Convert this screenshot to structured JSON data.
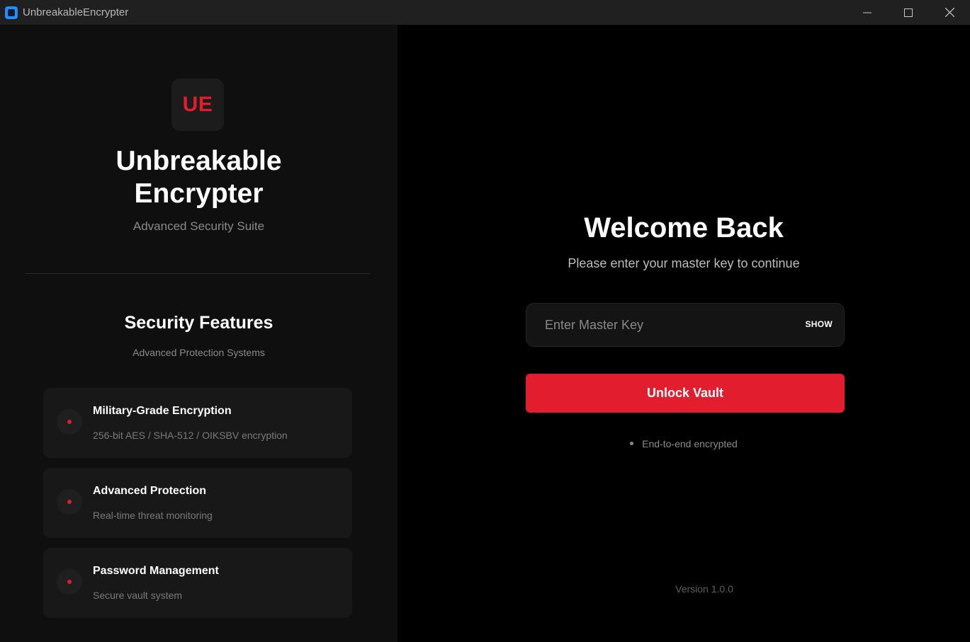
{
  "window": {
    "title": "UnbreakableEncrypter"
  },
  "sidebar": {
    "logo_text": "UE",
    "app_name_line1": "Unbreakable",
    "app_name_line2": "Encrypter",
    "tagline": "Advanced Security Suite",
    "features_title": "Security Features",
    "features_subtitle": "Advanced Protection Systems",
    "features": [
      {
        "title": "Military-Grade Encryption",
        "description": "256-bit AES / SHA-512 / OIKSBV encryption"
      },
      {
        "title": "Advanced Protection",
        "description": "Real-time threat monitoring"
      },
      {
        "title": "Password Management",
        "description": "Secure vault system"
      }
    ]
  },
  "login": {
    "heading": "Welcome Back",
    "subheading": "Please enter your master key to continue",
    "key_placeholder": "Enter Master Key",
    "key_value": "",
    "show_label": "SHOW",
    "unlock_label": "Unlock Vault",
    "e2e_label": "End-to-end encrypted",
    "version": "Version 1.0.0"
  },
  "colors": {
    "accent": "#e11d2e",
    "sidebar_bg": "#0f0f0f",
    "main_bg": "#000000",
    "card_bg": "#181818"
  },
  "icons": {
    "app": "app-icon",
    "minimize": "minimize-icon",
    "maximize": "maximize-icon",
    "close": "close-icon"
  }
}
